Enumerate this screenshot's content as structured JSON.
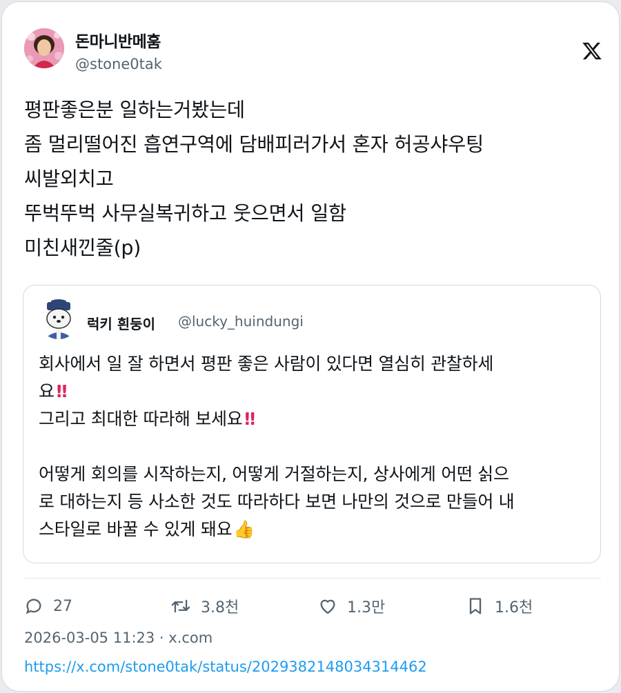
{
  "author": {
    "name": "돈마니반메훔",
    "handle": "@stone0tak"
  },
  "tweet_lines": [
    "평판좋은분 일하는거봤는데",
    "좀 멀리떨어진 흡연구역에 담배피러가서 혼자 허공샤우팅",
    "씨발외치고",
    "뚜벅뚜벅 사무실복귀하고 웃으면서 일함",
    "미친새낀줄(p)"
  ],
  "quote": {
    "name": "럭키 흰둥이",
    "handle": "@lucky_huindungi",
    "line1": "회사에서 일 잘 하면서 평판 좋은 사람이 있다면 열심히 관찰하세",
    "line2": "요",
    "line3": "그리고 최대한 따라해 보세요",
    "line5": "어떻게 회의를 시작하는지, 어떻게 거절하는지, 상사에게 어떤 싥으",
    "line6": "로 대하는지 등 사소한 것도 따라하다 보면 나만의 것으로 만들어 내",
    "line7": "스타일로 바꿀 수 있게 돼요",
    "emoji_excl": "‼",
    "emoji_thumb": "👍"
  },
  "actions": {
    "reply": "27",
    "retweet": "3.8천",
    "like": "1.3만",
    "bookmark": "1.6천"
  },
  "meta": "2026-03-05 11:23 · x.com",
  "url": "https://x.com/stone0tak/status/2029382148034314462",
  "icons": {
    "logo": "x-logo-icon",
    "reply": "speech-bubble-icon",
    "retweet": "retweet-arrows-icon",
    "like": "heart-icon",
    "bookmark": "bookmark-icon"
  }
}
